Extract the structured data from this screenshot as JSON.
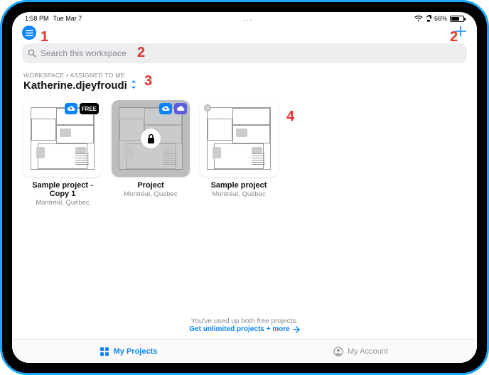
{
  "status": {
    "time": "1:58 PM",
    "date": "Tue Mar 7",
    "center_dots": "...",
    "battery_pct": "66%"
  },
  "header": {
    "list_button_name": "list",
    "add_button_name": "add"
  },
  "search": {
    "placeholder": "Search this workspace"
  },
  "workspace": {
    "label": "WORKSPACE • ASSIGNED TO ME",
    "title": "Katherine.djeyfroudi"
  },
  "projects": [
    {
      "title": "Sample project - Copy 1",
      "subtitle": "Montréal, Québec",
      "badges": [
        "cloud",
        "FREE"
      ],
      "locked": false,
      "caps_dot": false
    },
    {
      "title": "Project",
      "subtitle": "Montréal, Québec",
      "badges": [
        "cloud",
        "cloud2"
      ],
      "locked": true,
      "caps_dot": false
    },
    {
      "title": "Sample project",
      "subtitle": "Montréal, Québec",
      "badges": [],
      "locked": false,
      "caps_dot": true
    }
  ],
  "upsell": {
    "line1": "You've used up both free projects.",
    "line2": "Get unlimited projects + more"
  },
  "tabbar": {
    "tab1": "My Projects",
    "tab2": "My Account"
  },
  "callouts": {
    "c1": "1",
    "c2": "2",
    "c3": "3",
    "c4a": "2",
    "c4": "4"
  }
}
